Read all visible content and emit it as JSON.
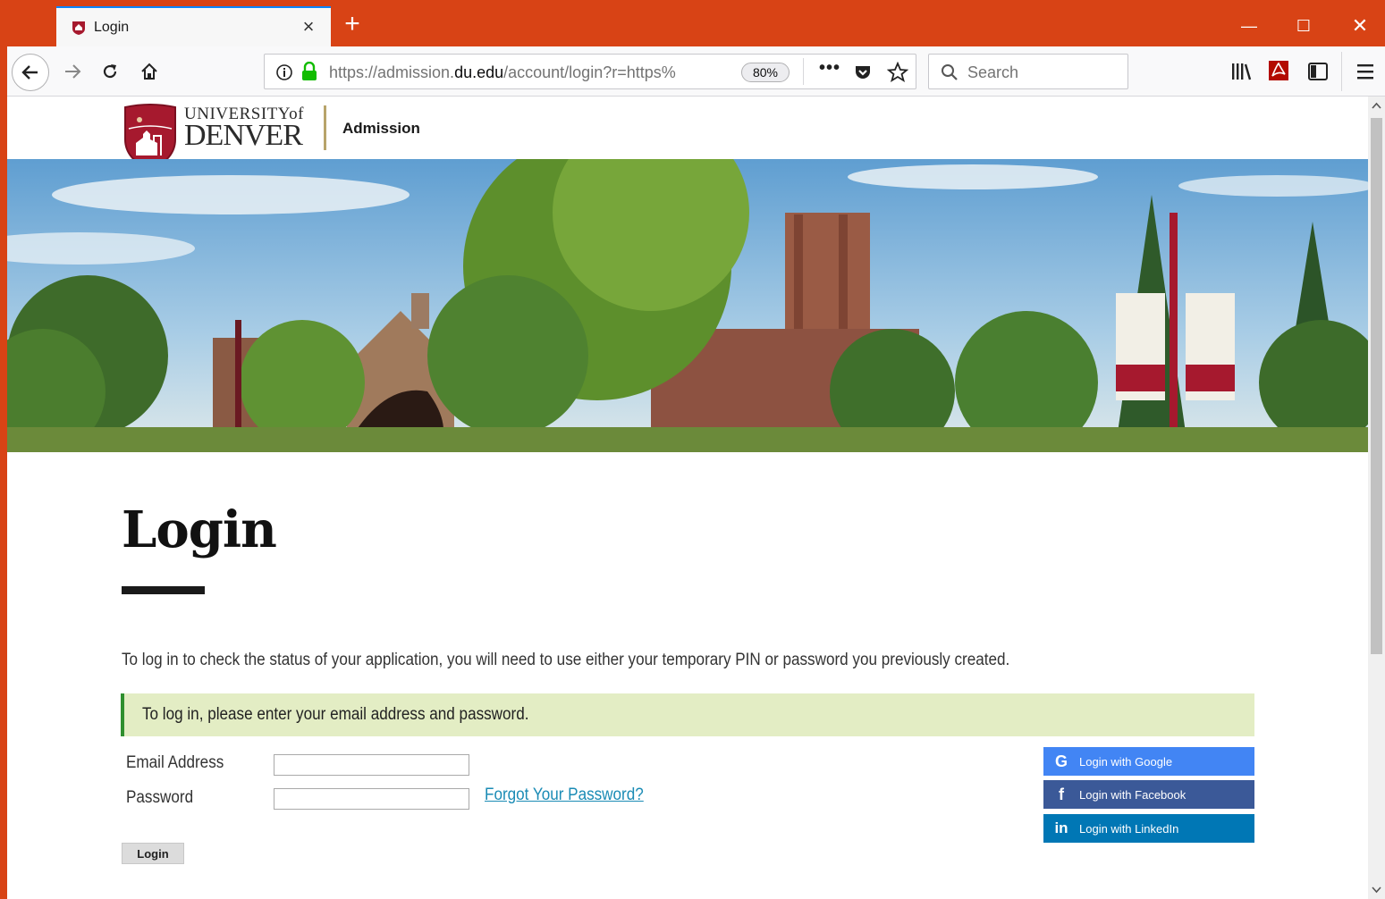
{
  "browser": {
    "tab_title": "Login",
    "url_prefix": "https://admission.",
    "url_domain": "du.edu",
    "url_path": "/account/login?r=https%",
    "zoom": "80%",
    "search_placeholder": "Search"
  },
  "header": {
    "logo_line1": "UNIVERSITYof",
    "logo_line2": "DENVER",
    "section": "Admission"
  },
  "main": {
    "title": "Login",
    "intro": "To log in to check the status of your application, you will need to use either your temporary PIN or password you previously created.",
    "notice": "To log in, please enter your email address and password.",
    "email_label": "Email Address",
    "email_value": "",
    "password_label": "Password",
    "password_value": "",
    "forgot_link": "Forgot Your Password?",
    "login_button": "Login"
  },
  "social": {
    "google": "Login with Google",
    "facebook": "Login with Facebook",
    "linkedin": "Login with LinkedIn"
  },
  "colors": {
    "chrome_accent": "#d84315",
    "notice_bg": "#e3edc4",
    "notice_border": "#2f8f2f",
    "link": "#1a8bb5",
    "google": "#4285f4",
    "facebook": "#3b5998",
    "linkedin": "#0077b5",
    "du_crimson": "#a6192e"
  }
}
